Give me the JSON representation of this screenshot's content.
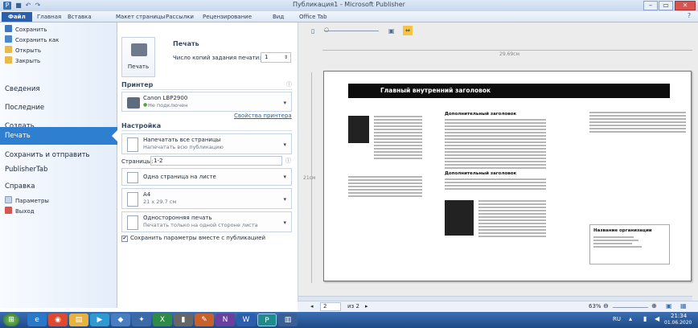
{
  "window": {
    "title": "Публикация1 - Microsoft Publisher",
    "buttons": {
      "minimize": "–",
      "maximize": "▭",
      "close": "✕"
    }
  },
  "tabs": [
    "Файл",
    "Главная",
    "Вставка",
    "Макет страницы",
    "Рассылки",
    "Рецензирование",
    "Вид",
    "Office Tab"
  ],
  "backstage_nav": {
    "small": [
      "Сохранить",
      "Сохранить как",
      "Открыть",
      "Закрыть"
    ],
    "big": [
      "Сведения",
      "Последние",
      "Создать",
      "Печать",
      "Сохранить и отправить",
      "PublisherTab",
      "Справка"
    ],
    "small_bottom": [
      "Параметры",
      "Выход"
    ]
  },
  "print": {
    "heading": "Печать",
    "print_button": "Печать",
    "copies_label": "Число копий задания печати:",
    "copies_value": "1",
    "printer_heading": "Принтер",
    "printer_name": "Canon LBP2900",
    "printer_status": "Не подключен",
    "printer_props_link": "Свойства принтера",
    "settings_heading": "Настройка",
    "pages_option": "Напечатать все страницы",
    "pages_option_sub": "Напечатать всю публикацию",
    "pages_label": "Страницы:",
    "pages_value": "1-2",
    "layout_option": "Одна страница на листе",
    "paper_size": "А4",
    "paper_dims": "21 x 29.7 см",
    "sides_option": "Односторонняя печать",
    "sides_sub": "Печатать только на одной стороне листа",
    "save_with_pub": "Сохранить параметры вместе с публикацией"
  },
  "preview": {
    "ruler_width": "29.69см",
    "ruler_height": "21см",
    "page_current": "2",
    "page_total": "из 2",
    "zoom": "63%",
    "banner_title": "Главный внутренний заголовок",
    "col2_heading": "Дополнительный заголовок",
    "col2_heading2": "Дополнительный заголовок",
    "contact_heading": "Название организации"
  },
  "taskbar": {
    "lang": "RU",
    "time": "21:34",
    "date": "01.06.2020"
  },
  "colors": {
    "accent": "#2f7fd1",
    "file_tab": "#2a5fae",
    "taskbar": "#1e4a86"
  }
}
